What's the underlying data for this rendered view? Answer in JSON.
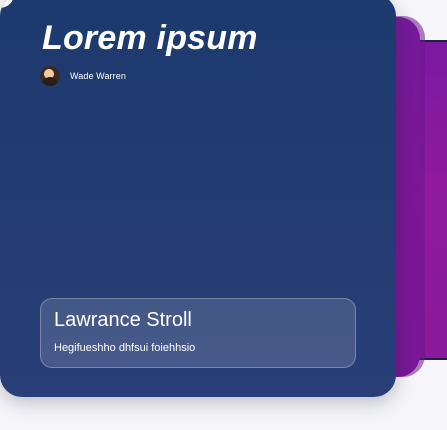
{
  "card": {
    "title": "Lorem ipsum",
    "author": {
      "name": "Wade Warren"
    },
    "info": {
      "name": "Lawrance Stroll",
      "description": "Hegifueshho dhfsui foiehhsio"
    }
  },
  "colors": {
    "card_background": "#223b71",
    "stack_accent": "#8a1a9e",
    "page_background": "#f6f6f9"
  }
}
